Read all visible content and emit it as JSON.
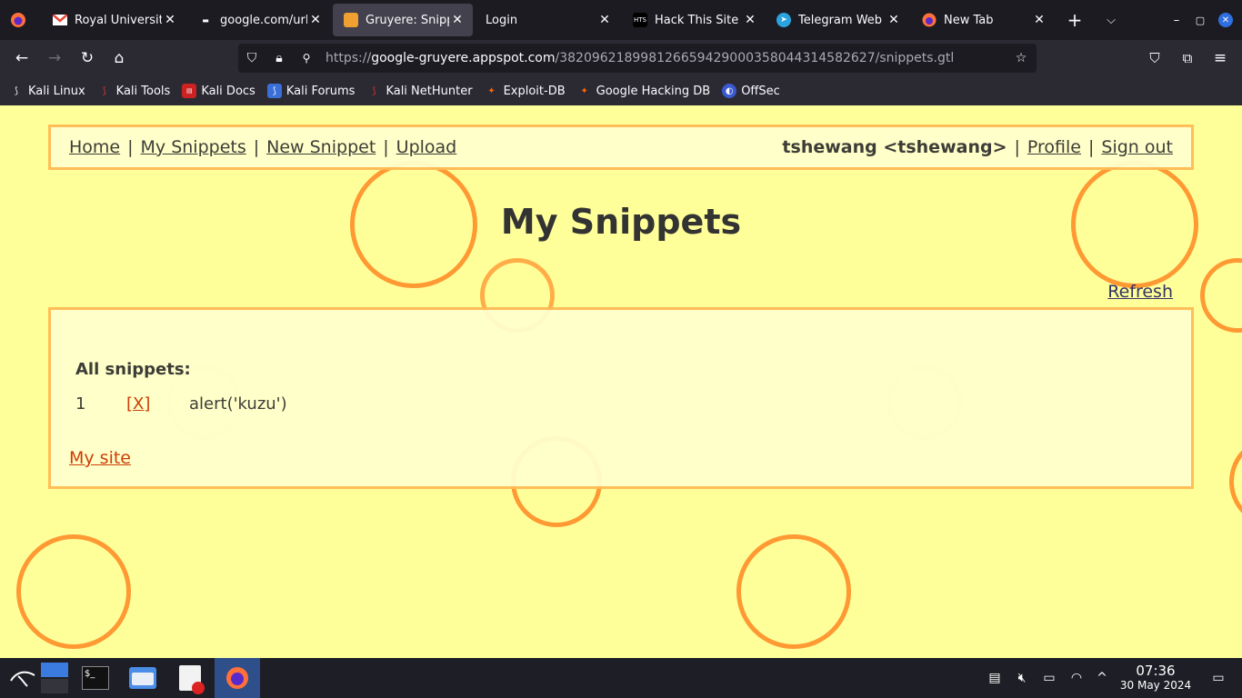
{
  "browser": {
    "tabs": [
      {
        "title": "Royal University",
        "icon": "gmail-icon",
        "active": false
      },
      {
        "title": "google.com/url?",
        "icon": "dot-icon",
        "active": false
      },
      {
        "title": "Gruyere: Snippets",
        "icon": "gruyere-icon",
        "active": true
      },
      {
        "title": "Login",
        "icon": "",
        "active": false
      },
      {
        "title": "Hack This Site",
        "icon": "hts-icon",
        "active": false
      },
      {
        "title": "Telegram Web",
        "icon": "telegram-icon",
        "active": false
      },
      {
        "title": "New Tab",
        "icon": "firefox-icon",
        "active": false
      }
    ],
    "url_prefix": "https://",
    "url_host": "google-gruyere.appspot.com",
    "url_path": "/382096218998126659429000358044314582627/snippets.gtl",
    "bookmarks": [
      "Kali Linux",
      "Kali Tools",
      "Kali Docs",
      "Kali Forums",
      "Kali NetHunter",
      "Exploit-DB",
      "Google Hacking DB",
      "OffSec"
    ]
  },
  "page": {
    "menu": {
      "home": "Home",
      "my_snippets": "My Snippets",
      "new_snippet": "New Snippet",
      "upload": "Upload",
      "sep": "|",
      "user": "tshewang <tshewang>",
      "profile": "Profile",
      "sign_out": "Sign out"
    },
    "title": "My Snippets",
    "refresh": "Refresh",
    "snippets_heading": "All snippets:",
    "snippets": [
      {
        "num": "1",
        "delete": "[X]",
        "text": "alert('kuzu')"
      }
    ],
    "my_site": "My site"
  },
  "taskbar": {
    "time": "07:36",
    "date": "30 May 2024"
  },
  "colors": {
    "page_bg": "#ffff99",
    "circle": "#ff9933",
    "link_red": "#cc3300"
  }
}
